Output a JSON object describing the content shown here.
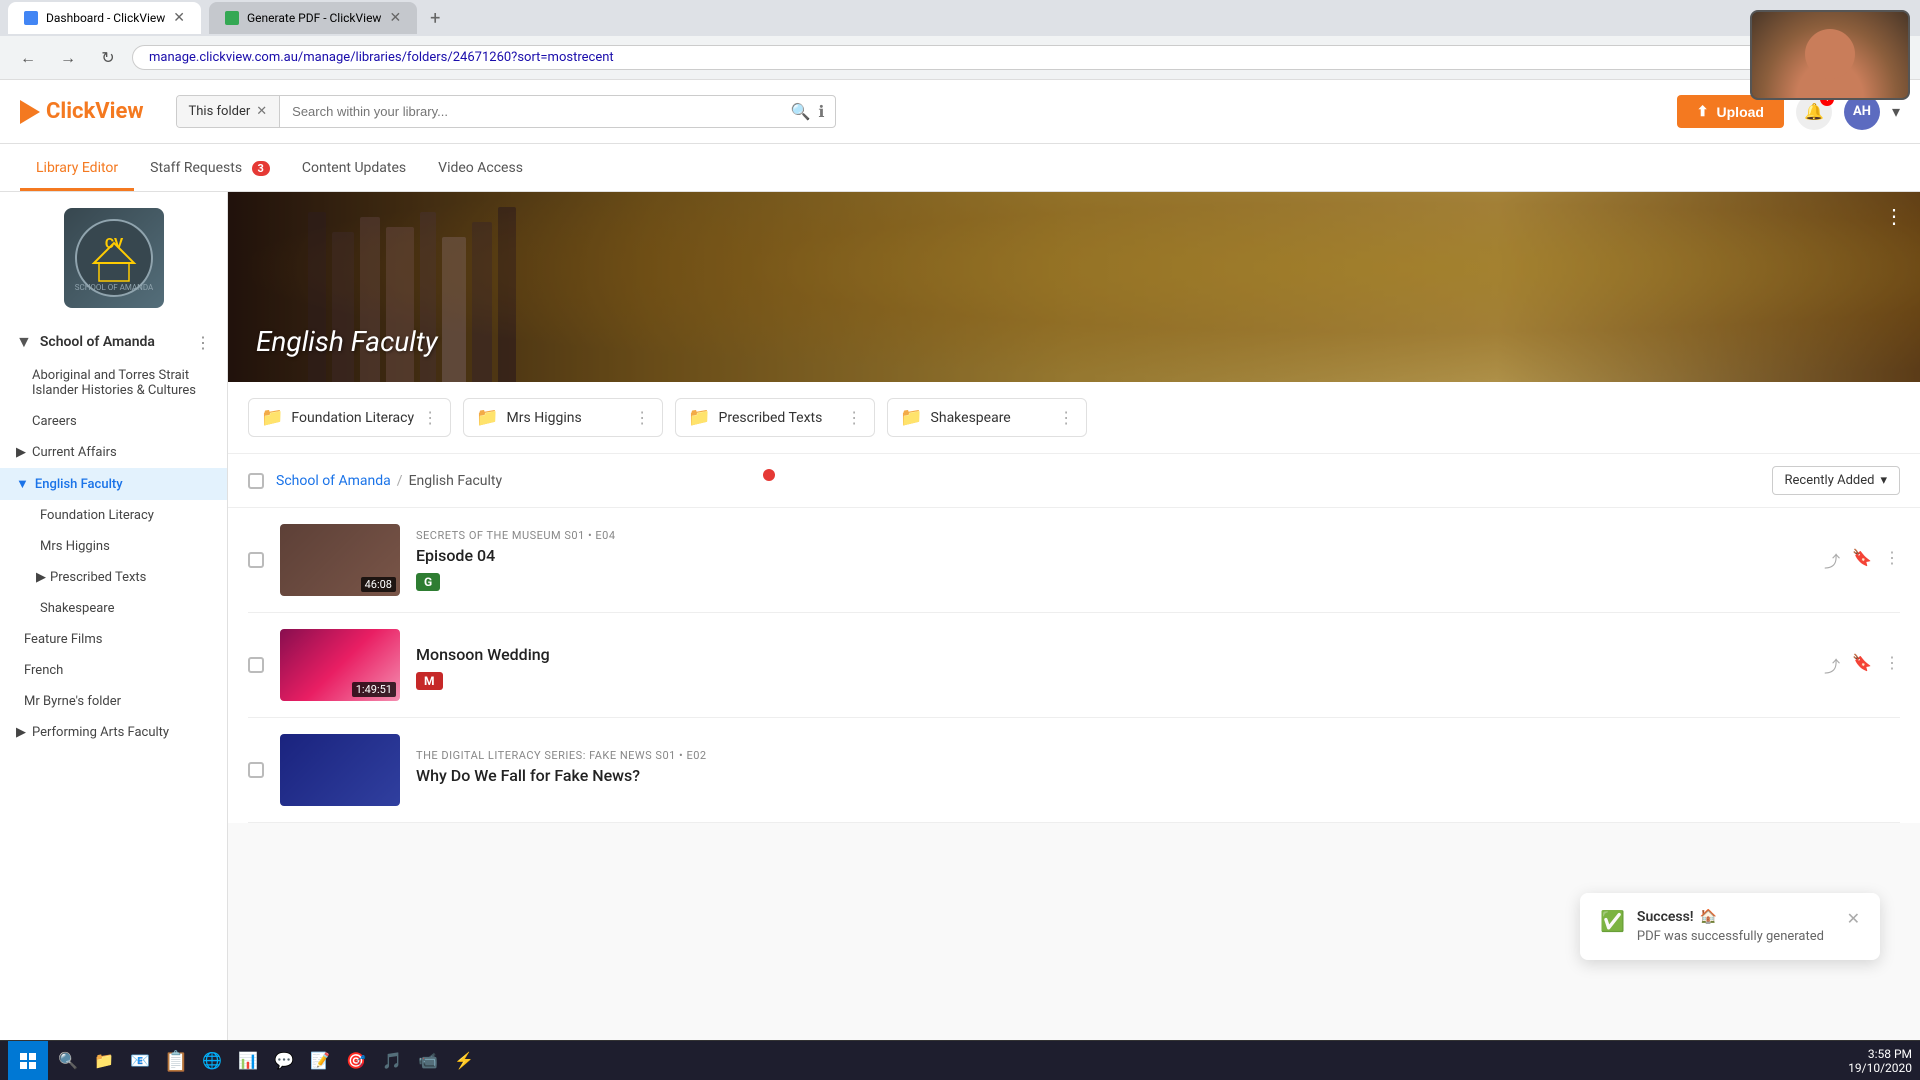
{
  "browser": {
    "tabs": [
      {
        "id": "tab1",
        "label": "Dashboard - ClickView",
        "active": true,
        "favicon_color": "#4285f4"
      },
      {
        "id": "tab2",
        "label": "Generate PDF - ClickView",
        "active": false,
        "favicon_color": "#34a853"
      }
    ],
    "url": "manage.clickview.com.au/manage/libraries/folders/24671260?sort=mostrecent"
  },
  "topbar": {
    "logo_text": "ClickView",
    "search_filter_label": "This folder",
    "search_placeholder": "Search within your library...",
    "upload_button_label": "Upload",
    "notif_count": "1",
    "avatar_initials": "AH"
  },
  "nav_tabs": [
    {
      "id": "library-editor",
      "label": "Library Editor",
      "active": true,
      "badge": null
    },
    {
      "id": "staff-requests",
      "label": "Staff Requests",
      "active": false,
      "badge": "3"
    },
    {
      "id": "content-updates",
      "label": "Content Updates",
      "active": false,
      "badge": null
    },
    {
      "id": "video-access",
      "label": "Video Access",
      "active": false,
      "badge": null
    }
  ],
  "sidebar": {
    "school_name": "School of Amanda",
    "items": [
      {
        "id": "aboriginal",
        "label": "Aboriginal and Torres Strait Islander Histories & Cultures",
        "active": false,
        "level": 1
      },
      {
        "id": "careers",
        "label": "Careers",
        "active": false,
        "level": 1
      },
      {
        "id": "current-affairs",
        "label": "Current Affairs",
        "active": false,
        "level": 0,
        "has_children": true,
        "expanded": false
      },
      {
        "id": "english-faculty",
        "label": "English Faculty",
        "active": true,
        "level": 0,
        "has_children": true,
        "expanded": true
      },
      {
        "id": "foundation-literacy",
        "label": "Foundation Literacy",
        "active": false,
        "level": 1
      },
      {
        "id": "mrs-higgins",
        "label": "Mrs Higgins",
        "active": false,
        "level": 1
      },
      {
        "id": "prescribed-texts",
        "label": "Prescribed Texts",
        "active": false,
        "level": 1,
        "has_children": true
      },
      {
        "id": "shakespeare",
        "label": "Shakespeare",
        "active": false,
        "level": 1
      },
      {
        "id": "feature-films",
        "label": "Feature Films",
        "active": false,
        "level": 0
      },
      {
        "id": "french",
        "label": "French",
        "active": false,
        "level": 0
      },
      {
        "id": "mr-byrnes-folder",
        "label": "Mr Byrne's folder",
        "active": false,
        "level": 0
      },
      {
        "id": "performing-arts",
        "label": "Performing Arts Faculty",
        "active": false,
        "level": 0,
        "has_children": true
      }
    ]
  },
  "hero": {
    "title": "English Faculty",
    "menu_icon": "⋮"
  },
  "folders": [
    {
      "id": "foundation-literacy",
      "name": "Foundation Literacy"
    },
    {
      "id": "mrs-higgins",
      "name": "Mrs Higgins"
    },
    {
      "id": "prescribed-texts",
      "name": "Prescribed Texts"
    },
    {
      "id": "shakespeare",
      "name": "Shakespeare"
    }
  ],
  "breadcrumb": {
    "root": "School of Amanda",
    "separator": "/",
    "current": "English Faculty"
  },
  "sort": {
    "label": "Recently Added",
    "icon": "▾"
  },
  "videos": [
    {
      "id": "v1",
      "series": "SECRETS OF THE MUSEUM S01 • E04",
      "title": "Episode 04",
      "rating": "G",
      "rating_class": "rating-g",
      "duration": "46:08",
      "thumb_bg": "linear-gradient(135deg, #5d4037, #795548)"
    },
    {
      "id": "v2",
      "series": "",
      "title": "Monsoon Wedding",
      "rating": "M",
      "rating_class": "rating-m",
      "duration": "1:49:51",
      "thumb_bg": "linear-gradient(135deg, #880e4f, #c2185b, #f48fb1)"
    },
    {
      "id": "v3",
      "series": "THE DIGITAL LITERACY SERIES: FAKE NEWS S01 • E02",
      "title": "Why Do We Fall for Fake News?",
      "rating": "",
      "rating_class": "",
      "duration": "",
      "thumb_bg": "linear-gradient(135deg, #1a237e, #283593)"
    }
  ],
  "toast": {
    "title": "Success!",
    "message": "PDF was successfully generated",
    "icon": "✓",
    "emoji": "🏠"
  },
  "taskbar": {
    "time": "3:58 PM",
    "date": "19/10/2020"
  },
  "book_spines": [
    {
      "color": "#4e342e"
    },
    {
      "color": "#6d4c41"
    },
    {
      "color": "#795548"
    },
    {
      "color": "#5d4037"
    },
    {
      "color": "#8d6e63"
    },
    {
      "color": "#a1887f"
    },
    {
      "color": "#6d4c41"
    },
    {
      "color": "#4e342e"
    }
  ]
}
